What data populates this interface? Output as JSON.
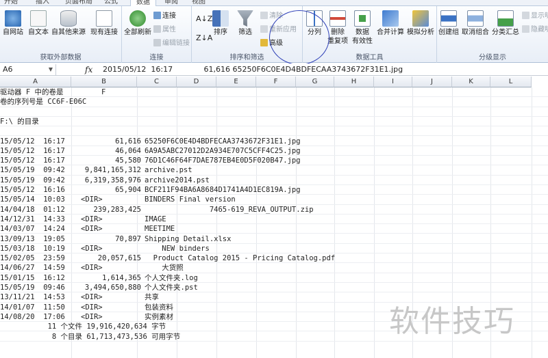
{
  "tabs": [
    "开始",
    "插入",
    "页面布局",
    "公式",
    "数据",
    "审阅",
    "视图"
  ],
  "ribbon": {
    "groups": {
      "external": "获取外部数据",
      "connections": "连接",
      "sort_filter": "排序和筛选",
      "data_tools": "数据工具",
      "outline": "分级显示"
    },
    "buttons": {
      "from_web": "自网站",
      "from_text": "自文本",
      "from_other": "自其他来源",
      "existing": "现有连接",
      "refresh_all": "全部刷新",
      "connections": "连接",
      "properties": "属性",
      "edit_links": "编辑链接",
      "sort": "排序",
      "filter": "筛选",
      "clear": "清除",
      "reapply": "重新应用",
      "advanced": "高级",
      "text_to_columns": "分列",
      "remove_dup_1": "删除",
      "remove_dup_2": "重复项",
      "validation_1": "数据",
      "validation_2": "有效性",
      "consolidate": "合并计算",
      "what_if": "模拟分析",
      "group": "创建组",
      "ungroup": "取消组合",
      "subtotal": "分类汇总",
      "show_detail": "显示明",
      "hide_detail": "隐藏明"
    }
  },
  "formula_bar": {
    "name_box": "A6",
    "fx": "fx",
    "value": "2015/05/12  16:17             61,616 65250F6C0E4D4BDFECAA3743672F31E1.jpg"
  },
  "columns": [
    "A",
    "B",
    "C",
    "D",
    "E",
    "F",
    "G",
    "H",
    "I",
    "J",
    "K",
    "L"
  ],
  "rows": [
    {
      "a": "驱动器 F 中的卷是",
      "b": "F",
      "c": ""
    },
    {
      "a": "卷的序列号是 CC6F-E06C",
      "b": "",
      "c": ""
    },
    {
      "a": "",
      "b": "",
      "c": ""
    },
    {
      "a": "F:\\ 的目录",
      "b": "",
      "c": ""
    },
    {
      "a": "",
      "b": "",
      "c": ""
    },
    {
      "a": "15/05/12  16:17",
      "b": "61,616",
      "c": "65250F6C0E4D4BDFECAA3743672F31E1.jpg"
    },
    {
      "a": "15/05/12  16:17",
      "b": "46,064",
      "c": "6A9A5ABC27012D2A934E707C5CFF4C25.jpg"
    },
    {
      "a": "15/05/12  16:17",
      "b": "45,580",
      "c": "76D1C46F64F7DAE787EB4E0D5F020B47.jpg"
    },
    {
      "a": "15/05/19  09:42",
      "b": "9,841,165,312",
      "c": "archive.pst"
    },
    {
      "a": "15/05/19  09:42",
      "b": "6,319,358,976",
      "c": "archive2014.pst"
    },
    {
      "a": "15/05/12  16:16",
      "b": "65,904",
      "c": "BCF211F94BA6A8684D1741A4D1EC819A.jpg"
    },
    {
      "a": "15/05/14  10:03",
      "b": "<DIR>",
      "c": "BINDERS Final version"
    },
    {
      "a": "14/04/18  01:12",
      "b": "239,283,425",
      "c": "               7465-619_REVA_OUTPUT.zip"
    },
    {
      "a": "14/12/31  14:33",
      "b": "<DIR>",
      "c": "IMAGE"
    },
    {
      "a": "14/03/07  14:24",
      "b": "<DIR>",
      "c": "MEETIME"
    },
    {
      "a": "13/09/13  19:05",
      "b": "70,897",
      "c": "Shipping Detail.xlsx"
    },
    {
      "a": "15/03/18  10:19",
      "b": "<DIR>",
      "c": "    NEW binders"
    },
    {
      "a": "15/02/05  23:59",
      "b": "20,057,615",
      "c": "  Product Catalog 2015 - Pricing Catalog.pdf"
    },
    {
      "a": "14/06/27  14:59",
      "b": "<DIR>",
      "c": "    大货照"
    },
    {
      "a": "15/01/15  16:12",
      "b": "1,614,365",
      "c": "个人文件夹.log"
    },
    {
      "a": "15/05/19  09:46",
      "b": "3,494,650,880",
      "c": "个人文件夹.pst"
    },
    {
      "a": "13/11/21  14:53",
      "b": "<DIR>",
      "c": "共享"
    },
    {
      "a": "14/01/07  11:50",
      "b": "<DIR>",
      "c": "包装资料"
    },
    {
      "a": "14/08/20  17:06",
      "b": "<DIR>",
      "c": "实例素材"
    },
    {
      "a": "           11 个文件 19,916,420,634 字节",
      "b": "",
      "c": ""
    },
    {
      "a": "            8 个目录 61,713,473,536 可用字节",
      "b": "",
      "c": ""
    }
  ],
  "watermark": "软件技巧"
}
